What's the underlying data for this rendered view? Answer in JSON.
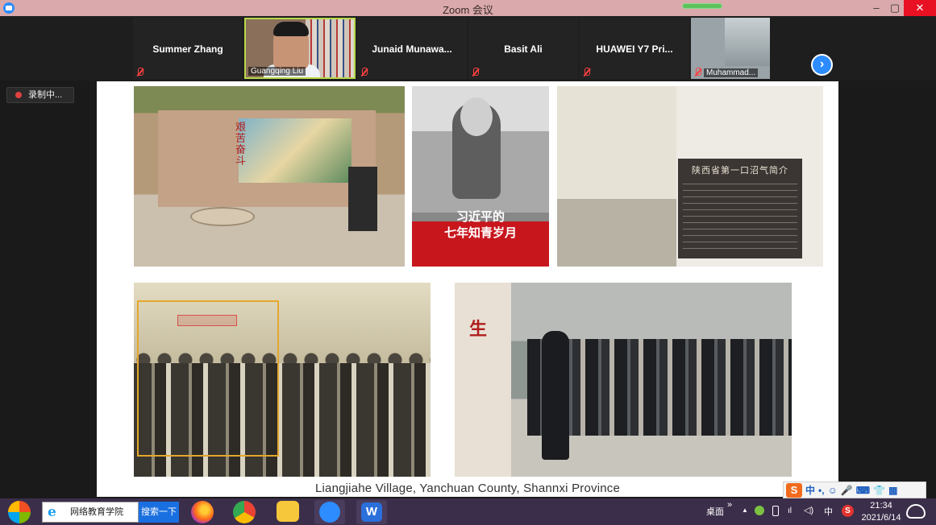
{
  "window": {
    "title": "Zoom 会议",
    "minimize": "–",
    "restore": "▢",
    "close": "✕"
  },
  "participants": [
    {
      "name": "Summer Zhang",
      "muted": true,
      "video": false
    },
    {
      "name": "Guangqing Liu",
      "muted": false,
      "video": true
    },
    {
      "name": "Junaid  Munawa...",
      "muted": true,
      "video": false
    },
    {
      "name": "Basit Ali",
      "muted": true,
      "video": false
    },
    {
      "name": "HUAWEI Y7 Pri...",
      "muted": true,
      "video": false
    },
    {
      "name": "Muhammad...",
      "muted": true,
      "video": true
    }
  ],
  "next_page_label": "›",
  "recording": {
    "label": "录制中..."
  },
  "slide": {
    "book_title_line1": "习近平的",
    "book_title_line2": "七年知青岁月",
    "mural_slogan": "艰苦奋斗",
    "plaque_title": "陕西省第一口沼气简介",
    "pillar_text": "生",
    "caption": "Liangjiahe Village, Yanchuan County, Shannxi Province"
  },
  "ime": {
    "logo": "S",
    "mode": "中",
    "items": [
      "•,",
      "☺",
      "🎤",
      "⌨",
      "👕",
      "▦"
    ]
  },
  "taskbar": {
    "browser_label": "网络教育学院",
    "search_button": "搜索一下",
    "desktop_label": "桌面",
    "tray_expand": "»",
    "tray_up": "▲",
    "input_mode": "中",
    "sogou": "S",
    "time": "21:34",
    "date": "2021/6/14"
  },
  "colors": {
    "titlebar": "#d9a9ab",
    "zoom_blue": "#2d8cff",
    "active_speaker_border": "#b7d94a",
    "muted_red": "#ff4040",
    "taskbar": "#3b2e4a"
  }
}
